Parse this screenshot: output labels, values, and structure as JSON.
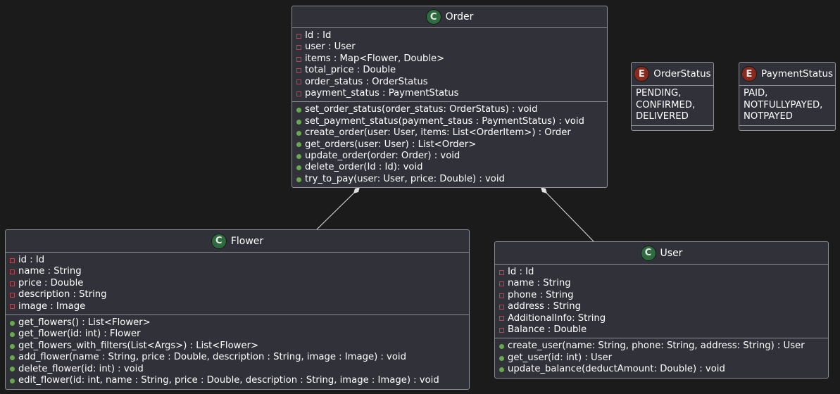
{
  "order": {
    "name": "Order",
    "stereotype": "C",
    "fields": [
      "Id : Id",
      "user : User",
      "items : Map<Flower, Double>",
      "total_price : Double",
      "order_status : OrderStatus",
      "payment_status : PaymentStatus"
    ],
    "methods": [
      "set_order_status(order_status: OrderStatus) : void",
      "set_payment_status(payment_staus : PaymentStatus) : void",
      "create_order(user: User, items: List<OrderItem>) : Order",
      "get_orders(user: User) : List<Order>",
      "update_order(order: Order) : void",
      "delete_order(Id : Id): void",
      "try_to_pay(user: User, price: Double) : void"
    ]
  },
  "order_status": {
    "name": "OrderStatus",
    "stereotype": "E",
    "values": [
      "PENDING,",
      "CONFIRMED,",
      "DELIVERED"
    ]
  },
  "payment_status": {
    "name": "PaymentStatus",
    "stereotype": "E",
    "values": [
      "PAID,",
      "NOTFULLYPAYED,",
      "NOTPAYED"
    ]
  },
  "flower": {
    "name": "Flower",
    "stereotype": "C",
    "fields": [
      "id : Id",
      "name : String",
      "price : Double",
      "description : String",
      "image : Image"
    ],
    "methods": [
      "get_flowers() : List<Flower>",
      "get_flower(id: int) : Flower",
      "get_flowers_with_filters(List<Args>) : List<Flower>",
      "add_flower(name : String, price : Double, description : String, image : Image) : void",
      "delete_flower(id: int) : void",
      "edit_flower(id: int, name : String, price : Double, description : String, image : Image) : void"
    ]
  },
  "user": {
    "name": "User",
    "stereotype": "C",
    "fields": [
      "Id : Id",
      "name : String",
      "phone : String",
      "address : String",
      "AdditionalInfo: String",
      "Balance : Double"
    ],
    "methods": [
      "create_user(name: String, phone: String, address: String) : User",
      "get_user(id: int) : User",
      "update_balance(deductAmount: Double) : void"
    ]
  }
}
